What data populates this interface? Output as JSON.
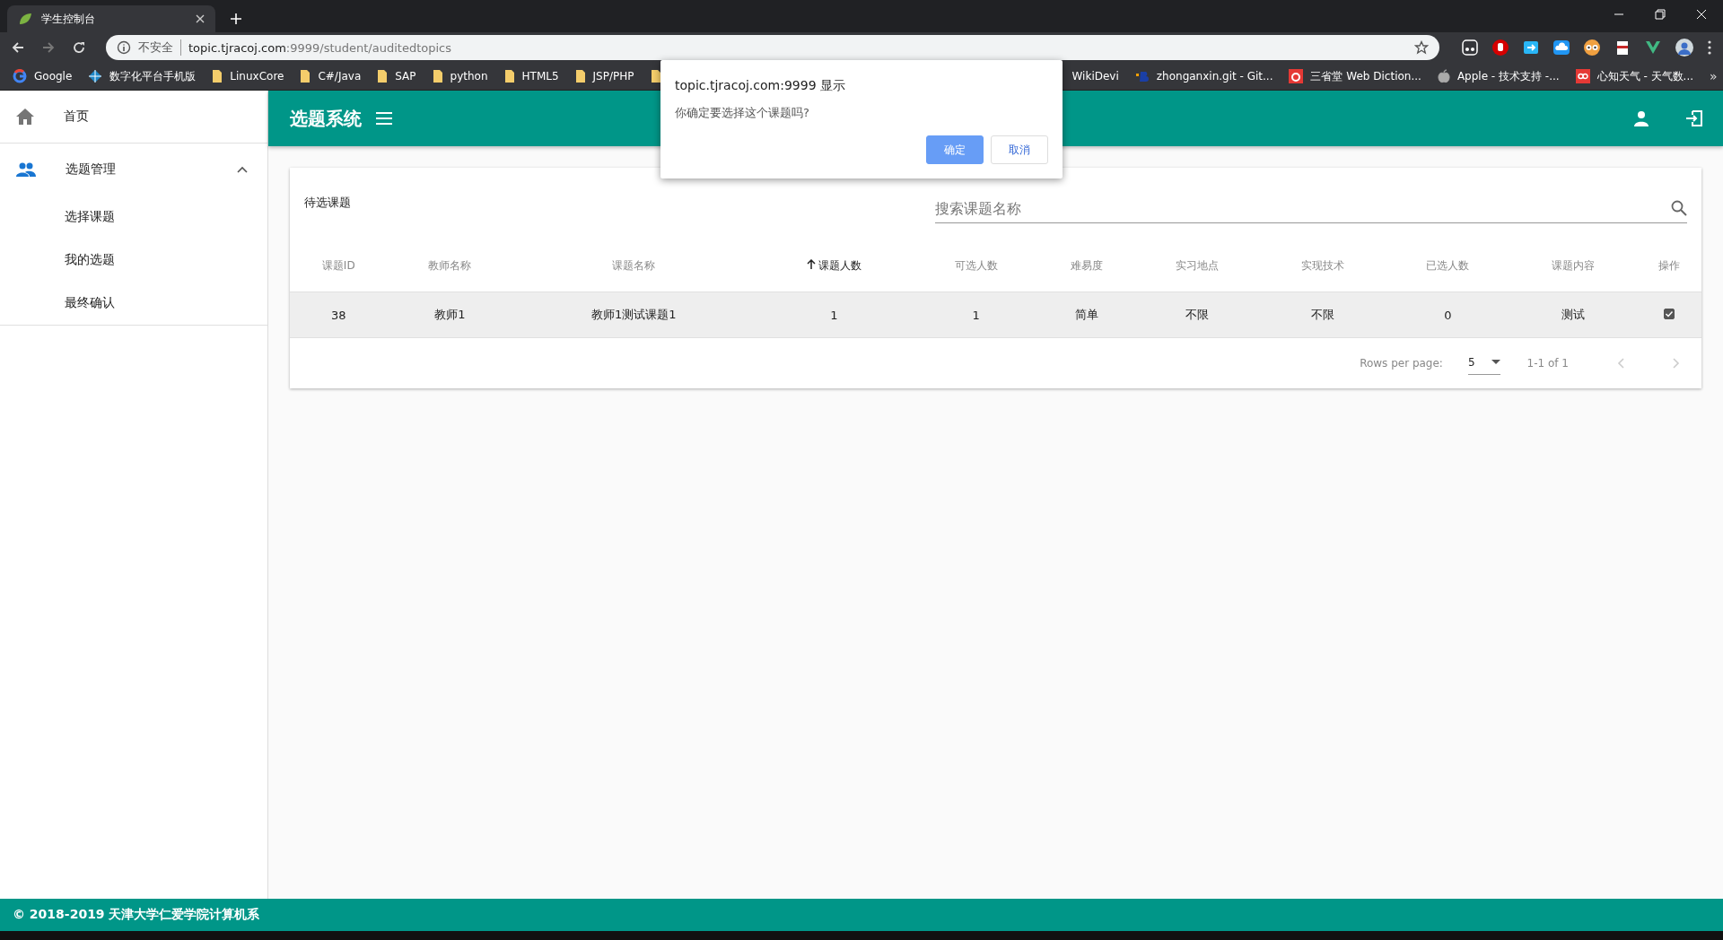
{
  "browser": {
    "tab_title": "学生控制台",
    "url_security": "不安全",
    "url_host": "topic.tjracoj.com",
    "url_path": ":9999/student/auditedtopics",
    "bookmarks": [
      {
        "kind": "google",
        "label": "Google"
      },
      {
        "kind": "globe",
        "label": "数字化平台手机版"
      },
      {
        "kind": "folder",
        "label": "LinuxCore"
      },
      {
        "kind": "folder",
        "label": "C#/Java"
      },
      {
        "kind": "folder",
        "label": "SAP"
      },
      {
        "kind": "folder",
        "label": "python"
      },
      {
        "kind": "folder",
        "label": "HTML5"
      },
      {
        "kind": "folder",
        "label": "JSP/PHP"
      },
      {
        "kind": "folder"
      },
      {
        "kind": "plain",
        "label": "WikiDevi"
      },
      {
        "kind": "logo",
        "label": "zhonganxin.git - Git..."
      },
      {
        "kind": "dict",
        "label": "三省堂 Web Diction..."
      },
      {
        "kind": "apple",
        "label": "Apple - 技术支持 -..."
      },
      {
        "kind": "weather",
        "label": "心知天气 - 天气数..."
      }
    ],
    "more": "»"
  },
  "sidebar": {
    "items": [
      {
        "kind": "home",
        "label": "首页"
      },
      {
        "kind": "group",
        "label": "选题管理",
        "expanded": true,
        "children": [
          {
            "label": "选择课题"
          },
          {
            "label": "我的选题"
          },
          {
            "label": "最终确认"
          }
        ]
      }
    ]
  },
  "header": {
    "title": "选题系统"
  },
  "card": {
    "title": "待选课题",
    "search": {
      "placeholder": "搜索课题名称"
    }
  },
  "table": {
    "columns": [
      {
        "label": "课题ID",
        "sorted": false
      },
      {
        "label": "教师名称",
        "sorted": false
      },
      {
        "label": "课题名称",
        "sorted": false
      },
      {
        "label": "课题人数",
        "sorted": true
      },
      {
        "label": "可选人数",
        "sorted": false
      },
      {
        "label": "难易度",
        "sorted": false
      },
      {
        "label": "实习地点",
        "sorted": false
      },
      {
        "label": "实现技术",
        "sorted": false
      },
      {
        "label": "已选人数",
        "sorted": false
      },
      {
        "label": "课题内容",
        "sorted": false
      },
      {
        "label": "操作",
        "sorted": false
      }
    ],
    "rows": [
      {
        "cells": [
          "38",
          "教师1",
          "教师1测试课题1",
          "1",
          "1",
          "简单",
          "不限",
          "不限",
          "0",
          "测试"
        ],
        "checked": true
      }
    ]
  },
  "pagination": {
    "rows_per_page_label": "Rows per page:",
    "rows_per_page": "5",
    "range": "1-1 of 1",
    "prev_disabled": true,
    "next_disabled": true
  },
  "footer": {
    "text": "© 2018-2019 天津大学仁爱学院计算机系"
  },
  "dialog": {
    "title": "topic.tjracoj.com:9999 显示",
    "message": "你确定要选择这个课题吗?",
    "buttons": [
      {
        "label": "确定",
        "primary": true
      },
      {
        "label": "取消",
        "primary": false
      }
    ]
  }
}
